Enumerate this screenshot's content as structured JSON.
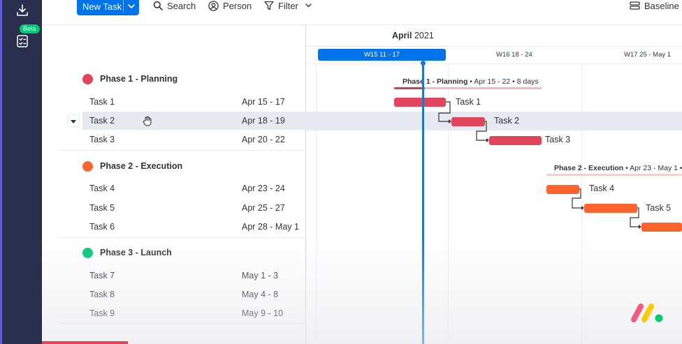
{
  "toolbar": {
    "new_task_label": "New Task",
    "search_label": "Search",
    "person_label": "Person",
    "filter_label": "Filter",
    "baseline_label": "Baseline"
  },
  "sidebar": {
    "beta_label": "Beta"
  },
  "timeline": {
    "month": "April",
    "year": "2021",
    "weeks": [
      {
        "label": "W15  11 - 17",
        "current": true
      },
      {
        "label": "W16  18 - 24",
        "current": false
      },
      {
        "label": "W17  25 - May 1",
        "current": false
      }
    ]
  },
  "groups": [
    {
      "name": "Phase 1 - Planning",
      "color": "#e2445c",
      "summary_name": "Phase 1 - Planning",
      "summary_detail": " • Apr 15 - 22 • 8 days",
      "tasks": [
        {
          "name": "Task 1",
          "dates": "Apr 15 - 17"
        },
        {
          "name": "Task 2",
          "dates": "Apr 18 - 19"
        },
        {
          "name": "Task 3",
          "dates": "Apr 20 - 22"
        }
      ]
    },
    {
      "name": "Phase 2 - Execution",
      "color": "#ff642e",
      "summary_name": "Phase 2 - Execution",
      "summary_detail": " • Apr 23 - May 1 •",
      "tasks": [
        {
          "name": "Task 4",
          "dates": "Apr 23 - 24"
        },
        {
          "name": "Task 5",
          "dates": "Apr 25 - 27"
        },
        {
          "name": "Task 6",
          "dates": "Apr 28 - May 1"
        }
      ]
    },
    {
      "name": "Phase 3 - Launch",
      "color": "#00c875",
      "tasks": [
        {
          "name": "Task 7",
          "dates": "May 1 - 3"
        },
        {
          "name": "Task 8",
          "dates": "May 4 - 8"
        },
        {
          "name": "Task 9",
          "dates": "May 9 - 10"
        }
      ]
    }
  ],
  "selected_task": "Task 2",
  "colors": {
    "accent": "#0073ea",
    "today_line": "#1f76c2"
  }
}
